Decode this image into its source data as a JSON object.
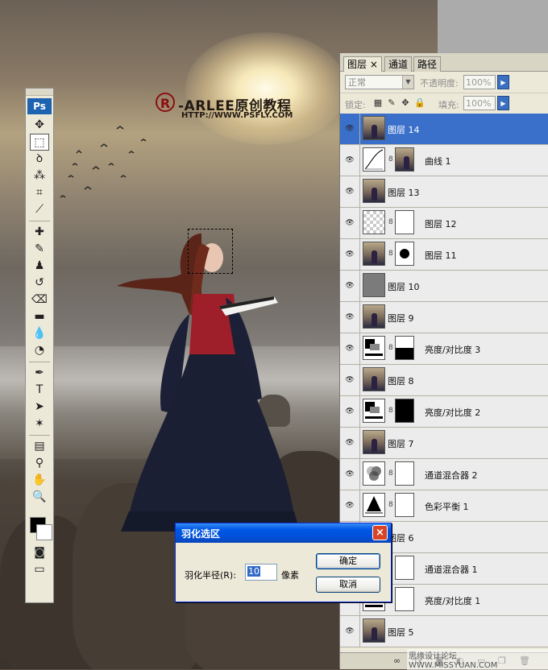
{
  "watermark": {
    "logo_glyph": "R",
    "title": "-ARLEE原创教程",
    "url": "HTTP://WWW.PSFLY.COM"
  },
  "toolbox": {
    "logo": "Ps",
    "tools": [
      {
        "name": "move-tool-icon",
        "glyph": "✥"
      },
      {
        "name": "marquee-tool-icon",
        "glyph": "⬚",
        "active": true
      },
      {
        "name": "lasso-tool-icon",
        "glyph": "ꝺ"
      },
      {
        "name": "magic-wand-tool-icon",
        "glyph": "⁂"
      },
      {
        "name": "crop-tool-icon",
        "glyph": "⌗"
      },
      {
        "name": "slice-tool-icon",
        "glyph": "⟋"
      },
      {
        "name": "healing-brush-tool-icon",
        "glyph": "✚"
      },
      {
        "name": "brush-tool-icon",
        "glyph": "✎"
      },
      {
        "name": "clone-stamp-tool-icon",
        "glyph": "♟"
      },
      {
        "name": "history-brush-tool-icon",
        "glyph": "↺"
      },
      {
        "name": "eraser-tool-icon",
        "glyph": "⌫"
      },
      {
        "name": "gradient-tool-icon",
        "glyph": "▬"
      },
      {
        "name": "blur-tool-icon",
        "glyph": "💧"
      },
      {
        "name": "dodge-tool-icon",
        "glyph": "◔"
      },
      {
        "name": "pen-tool-icon",
        "glyph": "✒"
      },
      {
        "name": "type-tool-icon",
        "glyph": "T"
      },
      {
        "name": "path-selection-tool-icon",
        "glyph": "➤"
      },
      {
        "name": "shape-tool-icon",
        "glyph": "✶"
      },
      {
        "name": "notes-tool-icon",
        "glyph": "▤"
      },
      {
        "name": "eyedropper-tool-icon",
        "glyph": "⚲"
      },
      {
        "name": "hand-tool-icon",
        "glyph": "✋"
      },
      {
        "name": "zoom-tool-icon",
        "glyph": "🔍"
      }
    ]
  },
  "layers_panel": {
    "tabs": [
      "图层",
      "通道",
      "路径"
    ],
    "active_tab_close": "×",
    "blend_mode": "正常",
    "opacity_label": "不透明度:",
    "opacity_value": "100%",
    "lock_label": "锁定:",
    "fill_label": "填充:",
    "fill_value": "100%",
    "layers": [
      {
        "name": "图层 14",
        "thumb": "photo",
        "selected": true
      },
      {
        "name": "曲线 1",
        "thumb": "curve",
        "mask": "photo"
      },
      {
        "name": "图层 13",
        "thumb": "photo"
      },
      {
        "name": "图层 12",
        "thumb": "checker",
        "mask": "white"
      },
      {
        "name": "图层 11",
        "thumb": "photo",
        "mask": "dot"
      },
      {
        "name": "图层 10",
        "thumb": "gray"
      },
      {
        "name": "图层 9",
        "thumb": "photo"
      },
      {
        "name": "亮度/对比度 3",
        "thumb": "bc",
        "mask": "black-white"
      },
      {
        "name": "图层 8",
        "thumb": "photo"
      },
      {
        "name": "亮度/对比度 2",
        "thumb": "bc",
        "mask": "black"
      },
      {
        "name": "图层 7",
        "thumb": "photo"
      },
      {
        "name": "通道混合器 2",
        "thumb": "mixer",
        "mask": "white"
      },
      {
        "name": "色彩平衡 1",
        "thumb": "balance",
        "mask": "white"
      },
      {
        "name": "图层 6",
        "thumb": "photo"
      },
      {
        "name": "通道混合器 1",
        "thumb": "mixer",
        "mask": "white"
      },
      {
        "name": "亮度/对比度 1",
        "thumb": "bc",
        "mask": "white"
      },
      {
        "name": "图层 5",
        "thumb": "photo"
      }
    ]
  },
  "dialog": {
    "title": "羽化选区",
    "close": "×",
    "radius_label": "羽化半径(R):",
    "radius_value": "10",
    "radius_unit": "像素",
    "ok_label": "确定",
    "cancel_label": "取消"
  },
  "forum_watermark": "思缘设计论坛 WWW.MISSYUAN.COM"
}
